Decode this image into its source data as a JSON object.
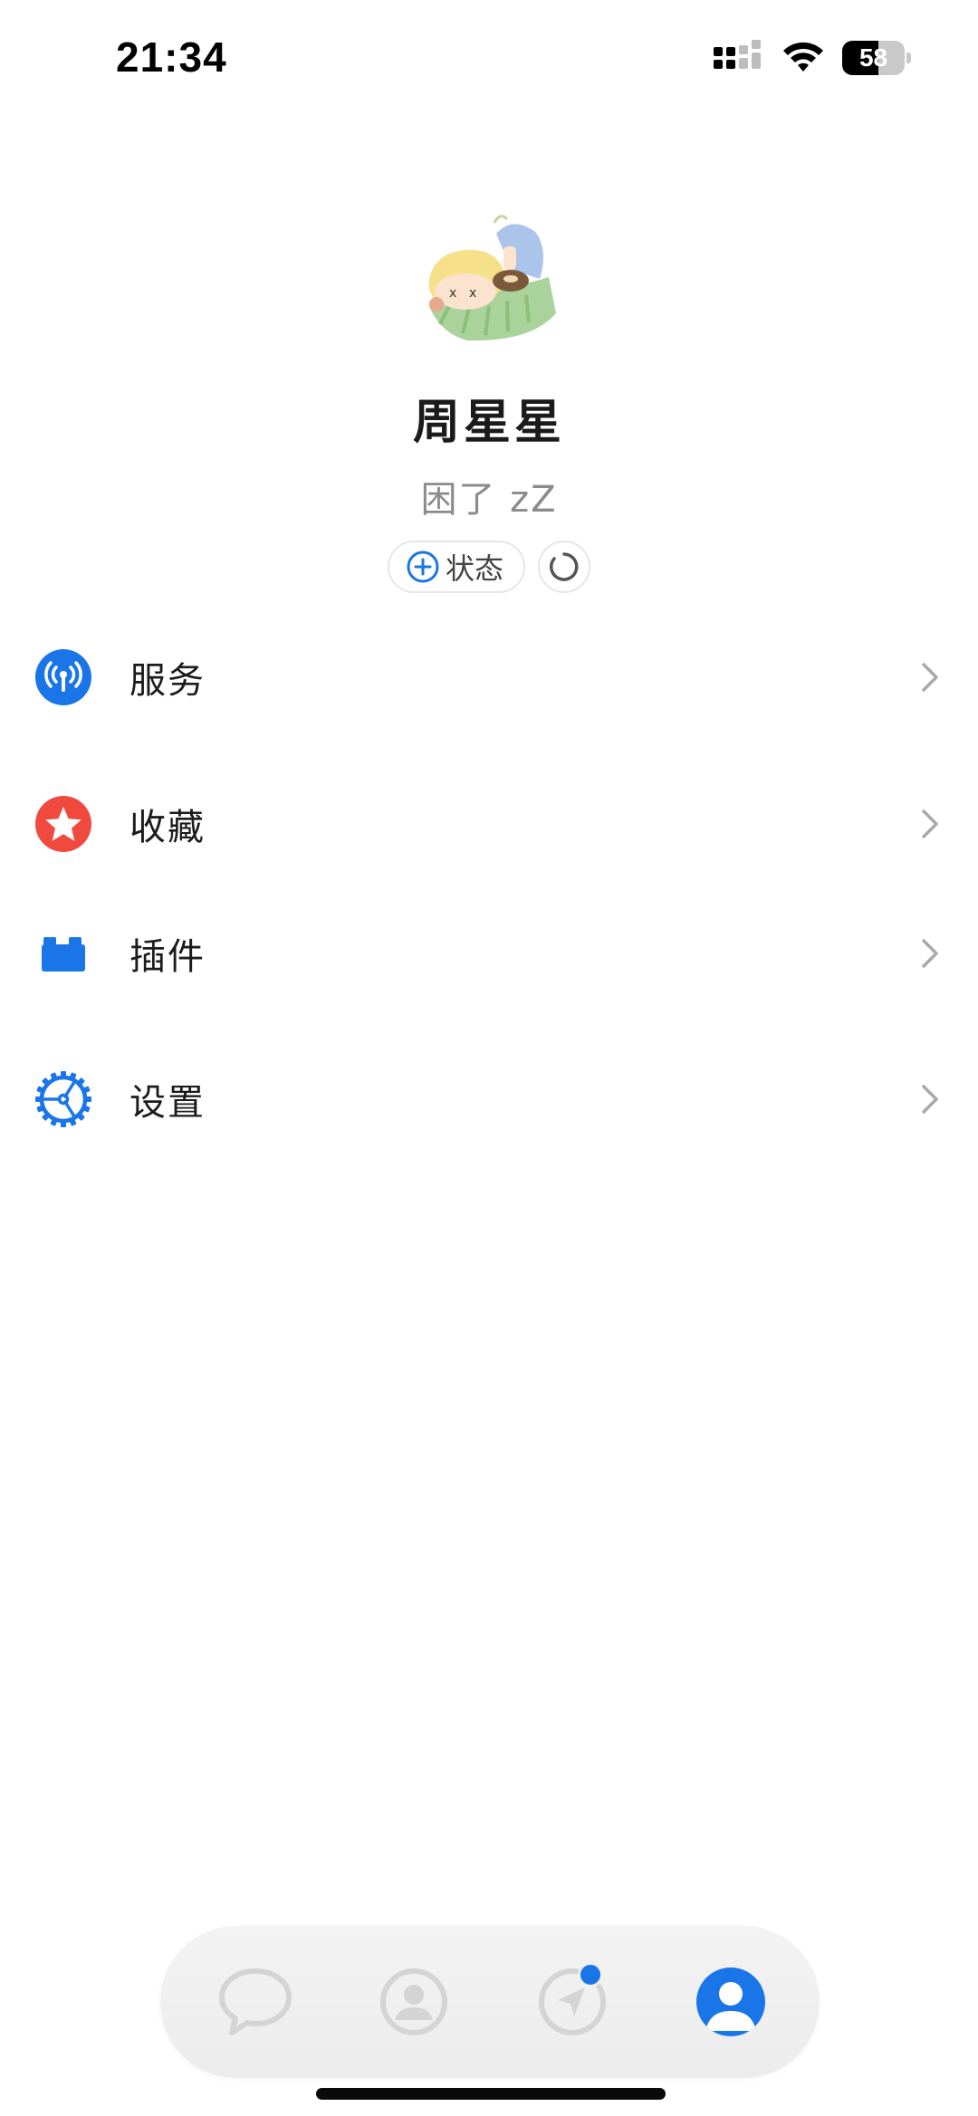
{
  "status_bar": {
    "time": "21:34",
    "battery_level": "58",
    "icons": [
      "cellular-signal-icon",
      "wifi-icon",
      "battery-icon"
    ]
  },
  "profile": {
    "name": "周星星",
    "signature": "困了 zZ",
    "status_button_label": "状态"
  },
  "menu": {
    "items": [
      {
        "label": "服务",
        "icon": "broadcast-icon"
      },
      {
        "label": "收藏",
        "icon": "star-icon"
      },
      {
        "label": "插件",
        "icon": "plugin-icon"
      },
      {
        "label": "设置",
        "icon": "gear-icon"
      }
    ]
  },
  "tab_bar": {
    "tabs": [
      {
        "name": "chat",
        "icon": "chat-bubble-icon",
        "active": false
      },
      {
        "name": "contacts",
        "icon": "contact-icon",
        "active": false
      },
      {
        "name": "discover",
        "icon": "compass-icon",
        "active": false,
        "has_badge": true
      },
      {
        "name": "me",
        "icon": "person-icon",
        "active": true
      }
    ]
  },
  "colors": {
    "accent_blue": "#1a76e8",
    "favorite_red": "#f04a3e",
    "secondary_text": "#8b8b8b"
  }
}
